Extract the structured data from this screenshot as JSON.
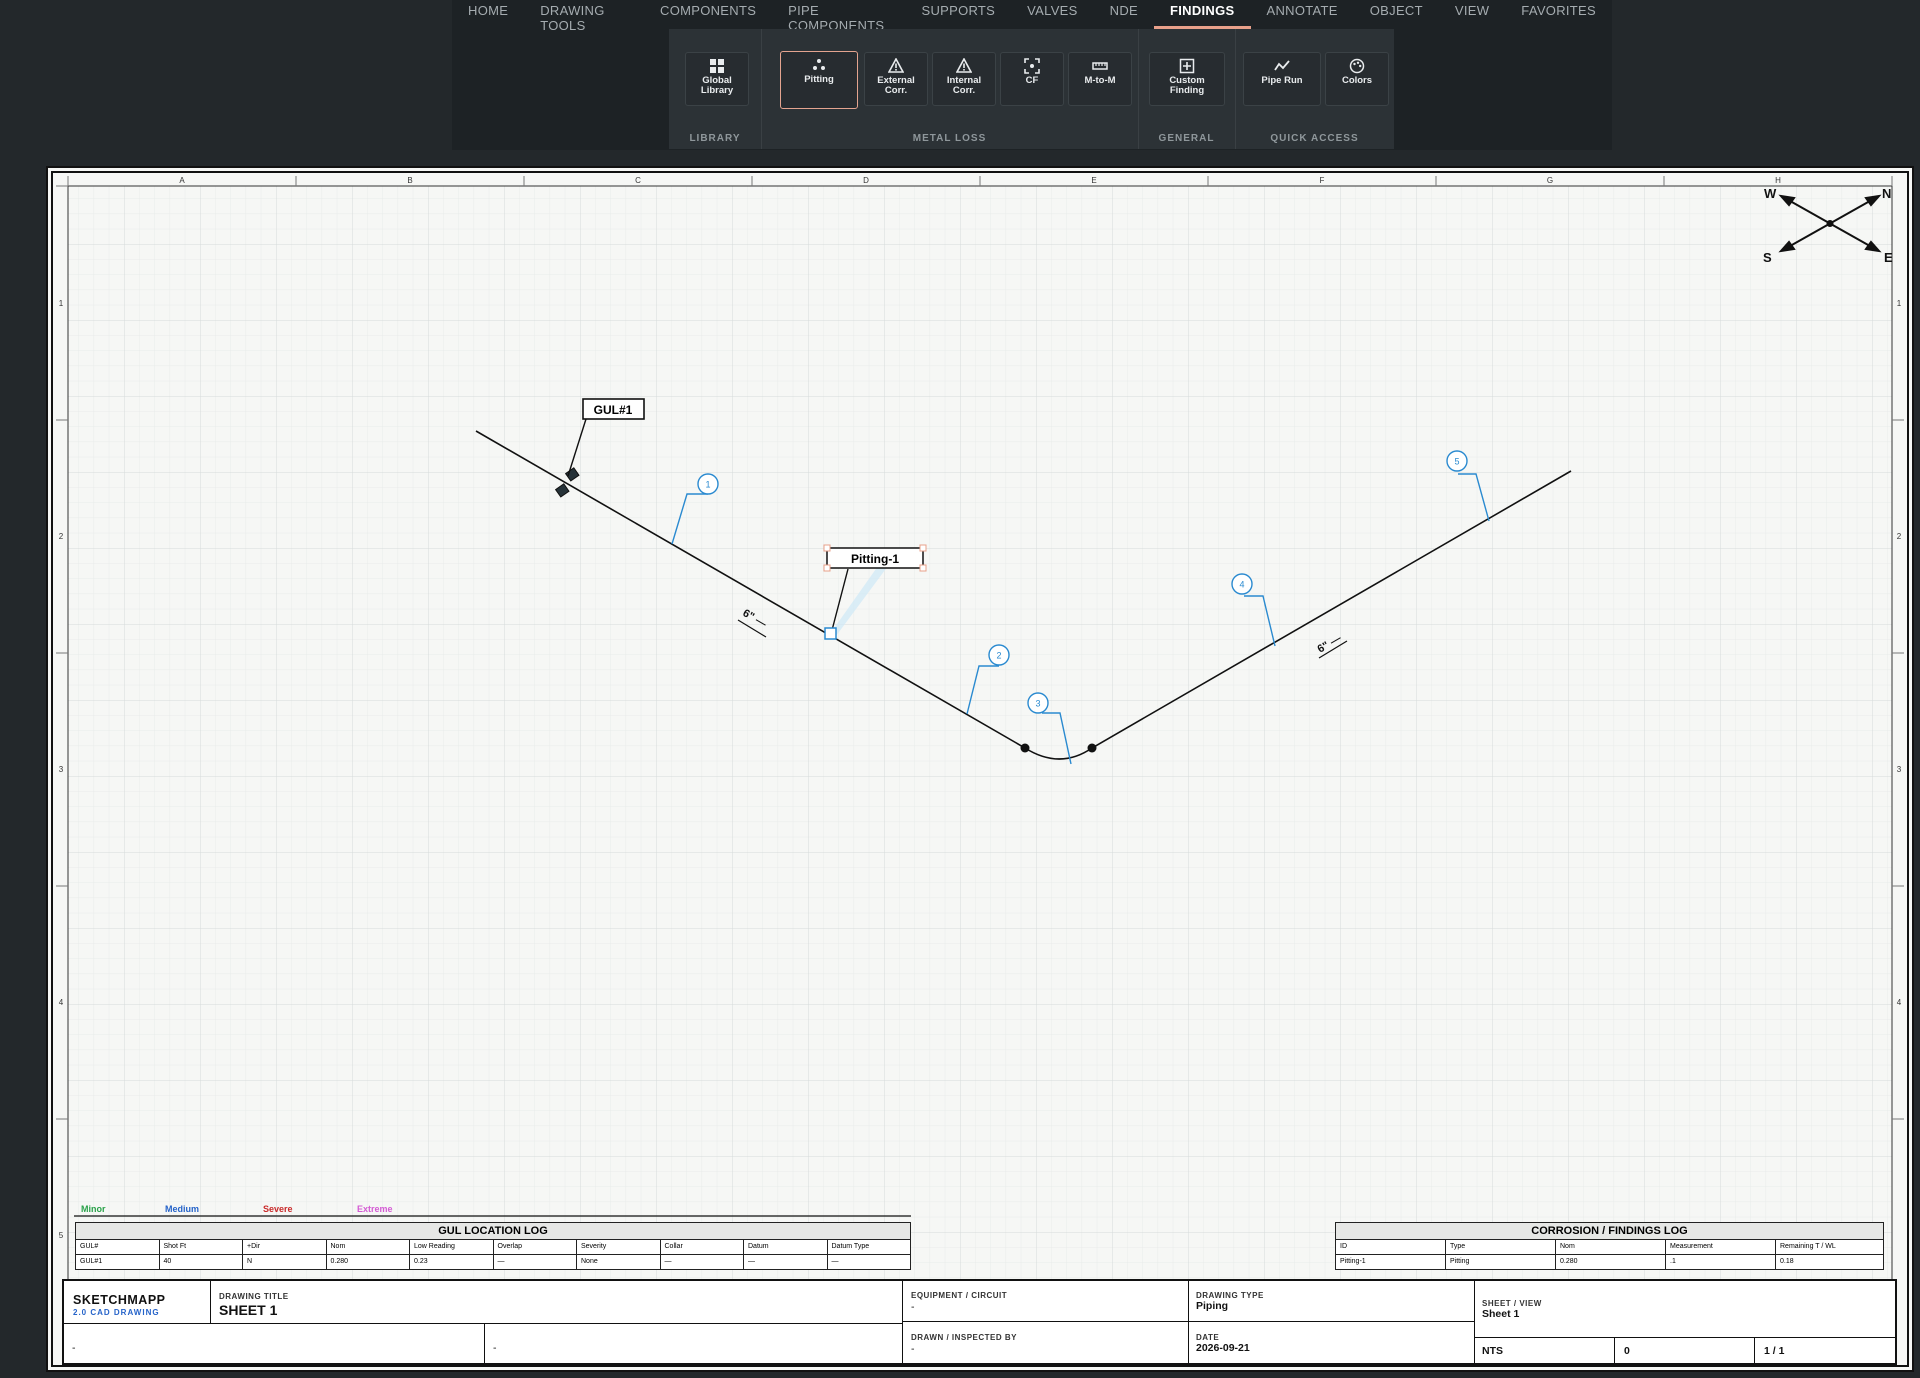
{
  "ribbon": {
    "tabs": [
      {
        "label": "HOME"
      },
      {
        "label": "DRAWING TOOLS"
      },
      {
        "label": "COMPONENTS"
      },
      {
        "label": "PIPE COMPONENTS"
      },
      {
        "label": "SUPPORTS"
      },
      {
        "label": "VALVES"
      },
      {
        "label": "NDE"
      },
      {
        "label": "FINDINGS"
      },
      {
        "label": "ANNOTATE"
      },
      {
        "label": "OBJECT"
      },
      {
        "label": "VIEW"
      },
      {
        "label": "FAVORITES"
      }
    ],
    "active_tab": "FINDINGS",
    "buttons": {
      "global_library": "Global Library",
      "pitting": "Pitting",
      "external_corr_1": "External",
      "external_corr_2": "Corr.",
      "internal_corr_1": "Internal",
      "internal_corr_2": "Corr.",
      "cf": "CF",
      "m_to_m": "M-to-M",
      "custom_finding_1": "Custom",
      "custom_finding_2": "Finding",
      "pipe_run": "Pipe Run",
      "colors": "Colors"
    },
    "groups": {
      "library": "LIBRARY",
      "metal_loss": "METAL LOSS",
      "general": "GENERAL",
      "quick_access": "QUICK ACCESS"
    },
    "accent": "#e8a08a"
  },
  "sheet": {
    "col_labels": [
      "A",
      "B",
      "C",
      "D",
      "E",
      "F",
      "G",
      "H"
    ],
    "row_labels": [
      "1",
      "2",
      "3",
      "4",
      "5"
    ],
    "compass": {
      "w": "W",
      "n": "N",
      "s": "S",
      "e": "E"
    },
    "tags": {
      "gul": "GUL#1",
      "pitting": "Pitting-1"
    },
    "bubbles": [
      "1",
      "2",
      "3",
      "4",
      "5"
    ],
    "dims": [
      "6\" —",
      "6\" —"
    ],
    "bubble_color": "#2a8ad0"
  },
  "legend": {
    "minor": {
      "label": "Minor",
      "color": "#2aa24a"
    },
    "medium": {
      "label": "Medium",
      "color": "#2563c9"
    },
    "severe": {
      "label": "Severe",
      "color": "#c92a2a"
    },
    "extreme": {
      "label": "Extreme",
      "color": "#d45bd4"
    }
  },
  "gul_log": {
    "title": "GUL LOCATION LOG",
    "headers": [
      "GUL#",
      "Shot Ft",
      "+Dir",
      "Nom",
      "Low Reading",
      "Overlap",
      "Severity",
      "Collar",
      "Datum",
      "Datum Type"
    ],
    "rows": [
      [
        "GUL#1",
        "40",
        "N",
        "0.280",
        "0.23",
        "—",
        "None",
        "—",
        "—",
        "—"
      ]
    ]
  },
  "corrosion_log": {
    "title": "CORROSION / FINDINGS LOG",
    "headers": [
      "ID",
      "Type",
      "Nom",
      "Measurement",
      "Remaining T / WL"
    ],
    "rows": [
      [
        "Pitting-1",
        "Pitting",
        "0.280",
        ".1",
        "0.18"
      ]
    ]
  },
  "title_block": {
    "brand": "SKETCHMAPP",
    "brand_sub": "2.0 CAD DRAWING",
    "drawing_title_label": "DRAWING TITLE",
    "drawing_title": "SHEET 1",
    "equipment_label": "EQUIPMENT / CIRCUIT",
    "equipment": "-",
    "drawing_type_label": "DRAWING TYPE",
    "drawing_type": "Piping",
    "sheet_view_label": "SHEET / VIEW",
    "sheet_view": "Sheet 1",
    "drawn_label": "DRAWN / INSPECTED BY",
    "drawn": "-",
    "date_label": "DATE",
    "date": "2026-09-21",
    "left_a": "-",
    "left_b": "-",
    "scale": "NTS",
    "rev": "0",
    "page": "1 / 1"
  }
}
